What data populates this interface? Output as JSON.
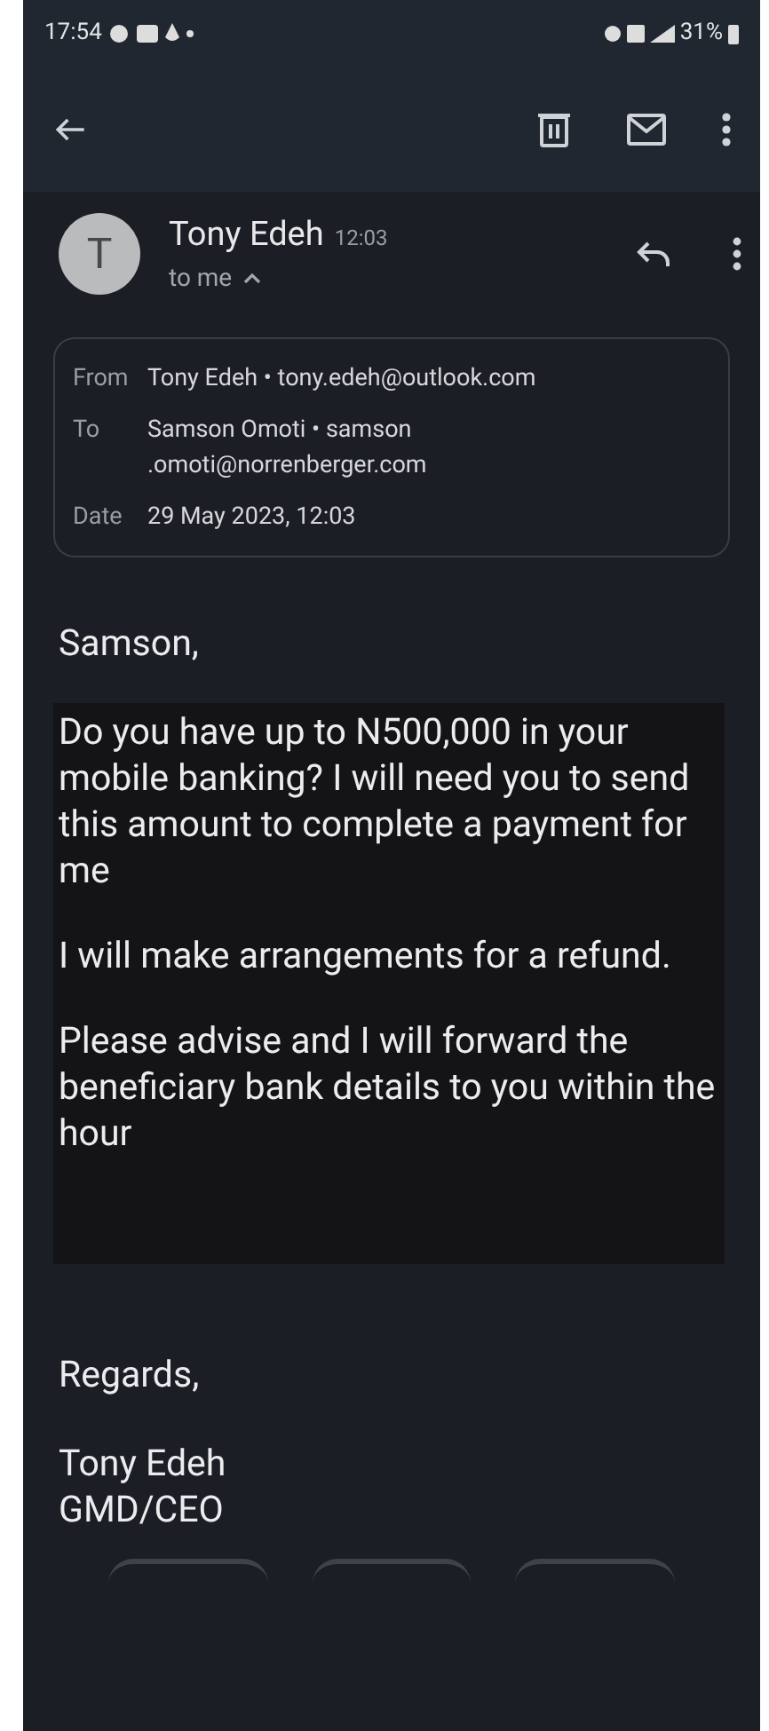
{
  "status_bar": {
    "time": "17:54",
    "battery": "31%"
  },
  "sender": {
    "initial": "T",
    "name": "Tony Edeh",
    "time": "12:03",
    "recipient": "to me",
    "details_expanded": true
  },
  "details": [
    {
      "label": "From",
      "lines": [
        "Tony Edeh • tony.edeh@outlook.com"
      ]
    },
    {
      "label": "To",
      "lines": [
        "Samson Omoti • samson",
        ".omoti@norrenberger.com"
      ]
    },
    {
      "label": "Date",
      "lines": [
        "29 May 2023, 12:03"
      ]
    }
  ],
  "greeting": "Samson,",
  "paragraphs": [
    "Do you have up to N500,000 in your mobile banking? I will need you to send this amount to complete a payment for me",
    "I will make arrangements for a refund.",
    "Please advise and I will forward the beneficiary bank details to you within the hour"
  ],
  "closing": "Regards,",
  "signature": [
    "Tony Edeh",
    "GMD/CEO"
  ]
}
